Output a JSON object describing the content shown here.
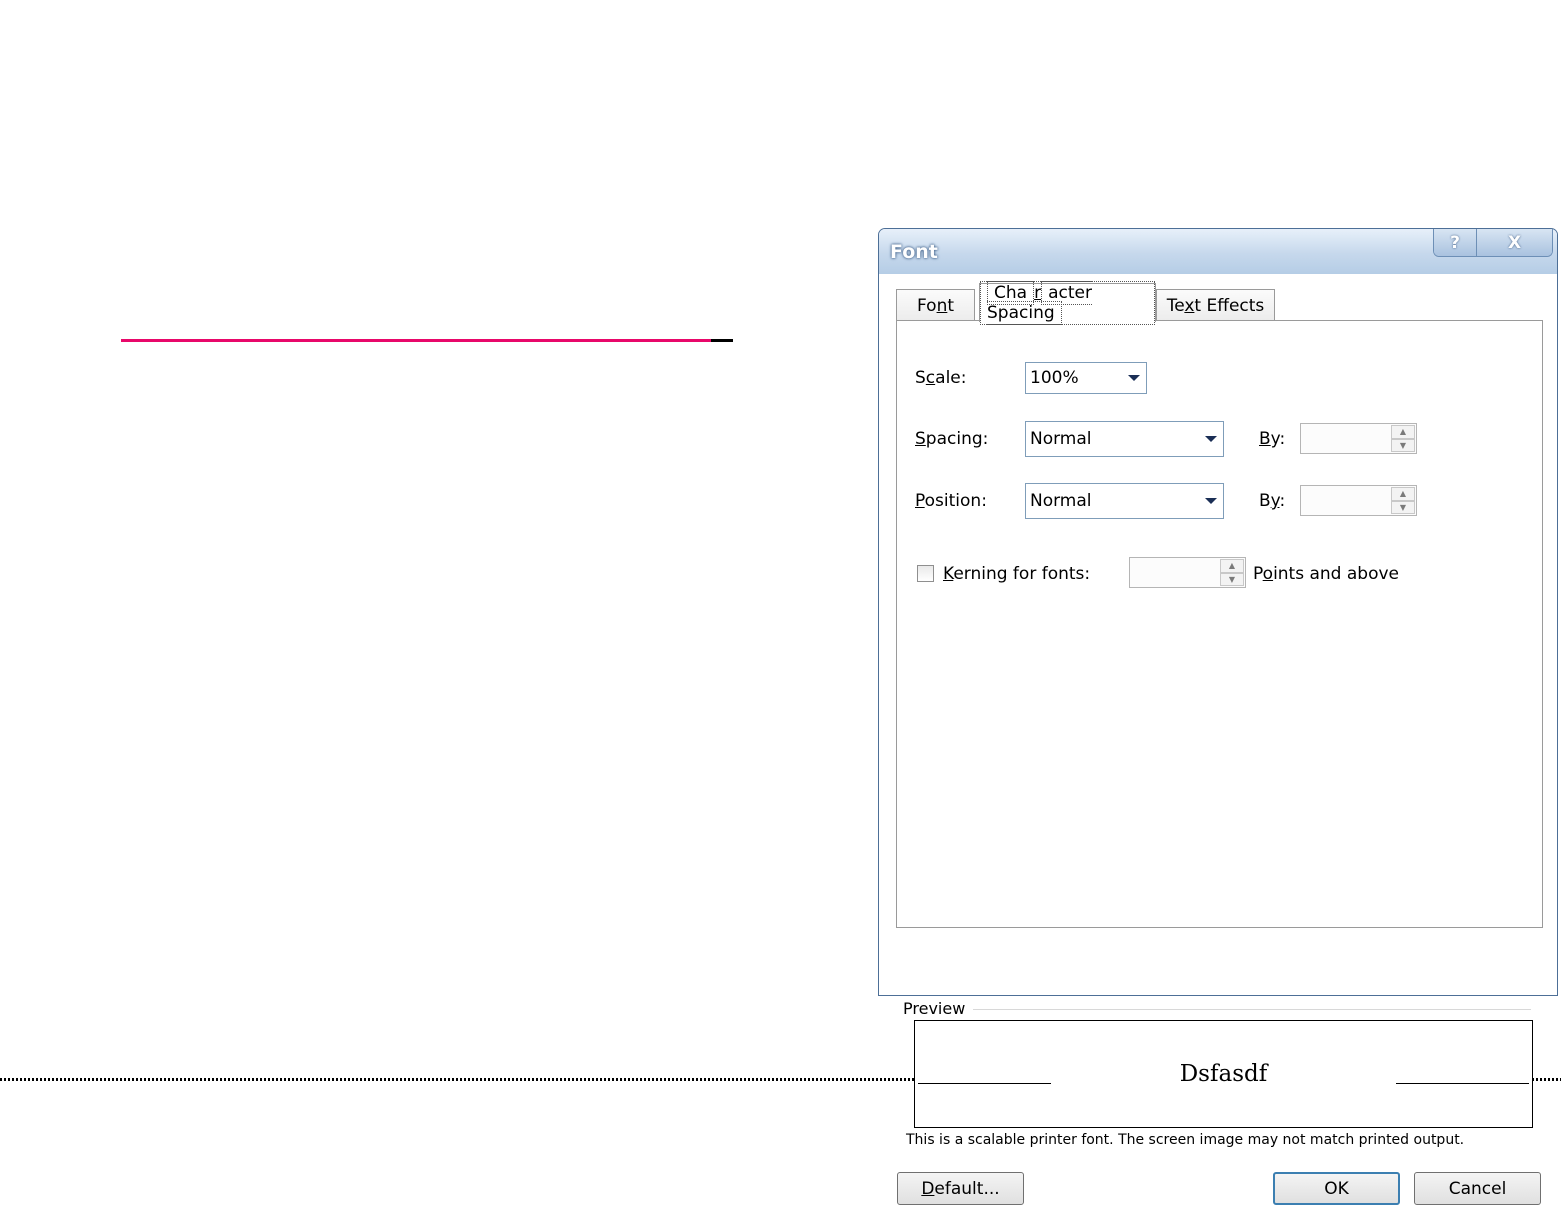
{
  "dialog": {
    "title": "Font",
    "help_glyph": "?",
    "close_glyph": "X"
  },
  "tabs": [
    {
      "pre": "Fo",
      "key": "n",
      "post": "t"
    },
    {
      "pre": "Cha",
      "key": "r",
      "post": "acter Spacing"
    },
    {
      "pre": "Te",
      "key": "x",
      "post": "t Effects"
    }
  ],
  "scale": {
    "label_pre": "S",
    "label_key": "c",
    "label_post": "ale:",
    "value": "100%"
  },
  "spacing": {
    "label_pre": "",
    "label_key": "S",
    "label_post": "pacing:",
    "value": "Normal",
    "by_pre": "",
    "by_key": "B",
    "by_post": "y:",
    "by_value": ""
  },
  "position": {
    "label_pre": "",
    "label_key": "P",
    "label_post": "osition:",
    "value": "Normal",
    "by_pre": "B",
    "by_key": "y",
    "by_post": ":",
    "by_value": ""
  },
  "kerning": {
    "label_pre": "",
    "label_key": "K",
    "label_post": "erning for fonts:",
    "checked": false,
    "value": "",
    "suffix_pre": "P",
    "suffix_key": "o",
    "suffix_post": "ints and above"
  },
  "preview": {
    "label": "Preview",
    "sample": "Dsfasdf",
    "note": "This is a scalable printer font. The screen image may not match printed output."
  },
  "buttons": {
    "default_pre": "",
    "default_key": "D",
    "default_post": "efault...",
    "ok": "OK",
    "cancel": "Cancel"
  },
  "colors": {
    "doc_line": "#e8086a",
    "title_gradient_top": "#e7f0fa",
    "title_gradient_bottom": "#b5cde6"
  }
}
